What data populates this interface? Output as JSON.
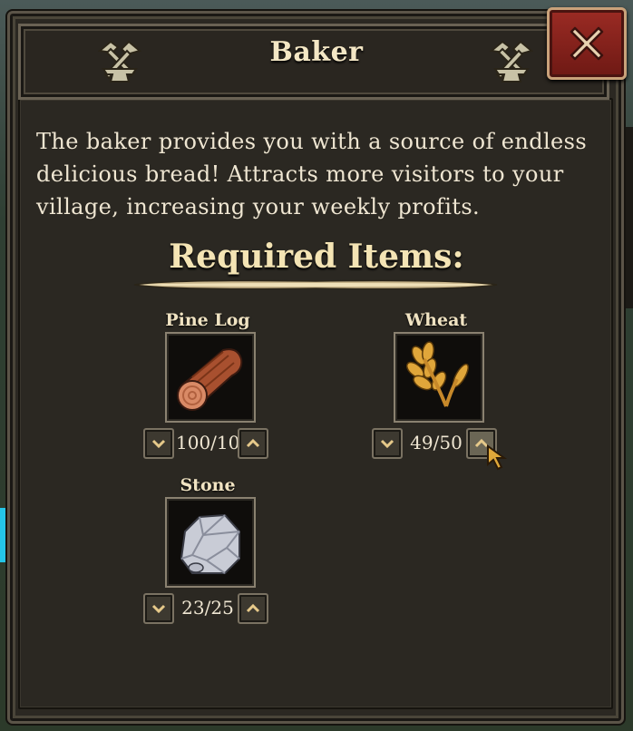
{
  "window": {
    "title": "Baker",
    "close_icon": "close-x-icon",
    "decor_icon": "hammer-anvil-icon"
  },
  "description": "The baker provides you with a source of endless delicious bread! Attracts more visitors to your village, increasing your weekly profits.",
  "required": {
    "title": "Required Items:",
    "items": [
      {
        "name": "Pine Log",
        "count": "100/100",
        "icon": "pine-log-icon",
        "current": 100,
        "total": 100
      },
      {
        "name": "Wheat",
        "count": "49/50",
        "icon": "wheat-icon",
        "current": 49,
        "total": 50
      },
      {
        "name": "Stone",
        "count": "23/25",
        "icon": "stone-icon",
        "current": 23,
        "total": 25
      }
    ]
  },
  "colors": {
    "panel": "#2b2822",
    "close_button": "#8b231d",
    "text": "#efe6d2",
    "title_text": "#f4e4b4"
  }
}
